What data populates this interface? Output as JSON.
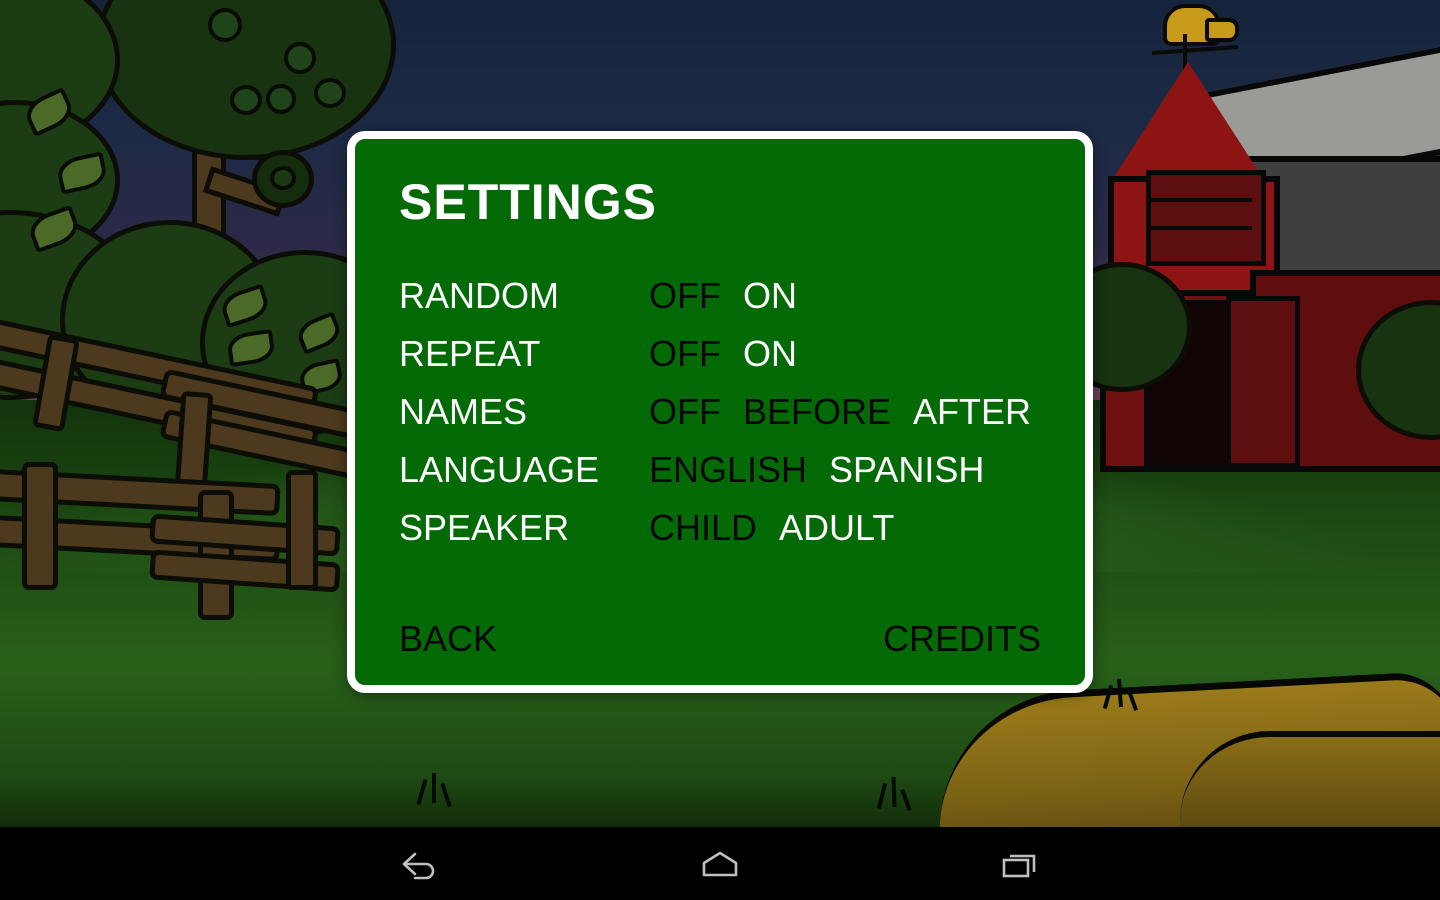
{
  "dialog": {
    "title": "SETTINGS",
    "rows": [
      {
        "label": "RANDOM",
        "options": [
          {
            "text": "OFF",
            "selected": false
          },
          {
            "text": "ON",
            "selected": true
          }
        ]
      },
      {
        "label": "REPEAT",
        "options": [
          {
            "text": "OFF",
            "selected": false
          },
          {
            "text": "ON",
            "selected": true
          }
        ]
      },
      {
        "label": "NAMES",
        "options": [
          {
            "text": "OFF",
            "selected": false
          },
          {
            "text": "BEFORE",
            "selected": false
          },
          {
            "text": "AFTER",
            "selected": true
          }
        ]
      },
      {
        "label": "LANGUAGE",
        "options": [
          {
            "text": "ENGLISH",
            "selected": false
          },
          {
            "text": "SPANISH",
            "selected": true
          }
        ]
      },
      {
        "label": "SPEAKER",
        "options": [
          {
            "text": "CHILD",
            "selected": false
          },
          {
            "text": "ADULT",
            "selected": true
          }
        ]
      }
    ],
    "footer": {
      "back_label": "BACK",
      "credits_label": "CREDITS"
    },
    "colors": {
      "panel_green": "#046A06",
      "border_white": "#FFFFFF",
      "selected_text": "#FFFFFF",
      "unselected_text": "#070707"
    }
  },
  "navbar": {
    "items": [
      {
        "name": "back-icon",
        "label": "Back"
      },
      {
        "name": "home-icon",
        "label": "Home"
      },
      {
        "name": "recents-icon",
        "label": "Recent apps"
      }
    ],
    "color": "#000000",
    "icon_color": "#BFBFBF"
  },
  "background": {
    "description": "Cartoon farm scene at dusk",
    "colors": {
      "sky_top": "#16233C",
      "sky_bottom": "#7A4A5C",
      "grass": "#28601A",
      "barn_red": "#8C1513",
      "barn_roof_gray": "#9A9A96",
      "rooster_gold": "#C79A1A",
      "fence_brown": "#4D3A1E",
      "haystack_gold": "#9A7A1A",
      "foliage_green": "#1C3D14"
    }
  }
}
